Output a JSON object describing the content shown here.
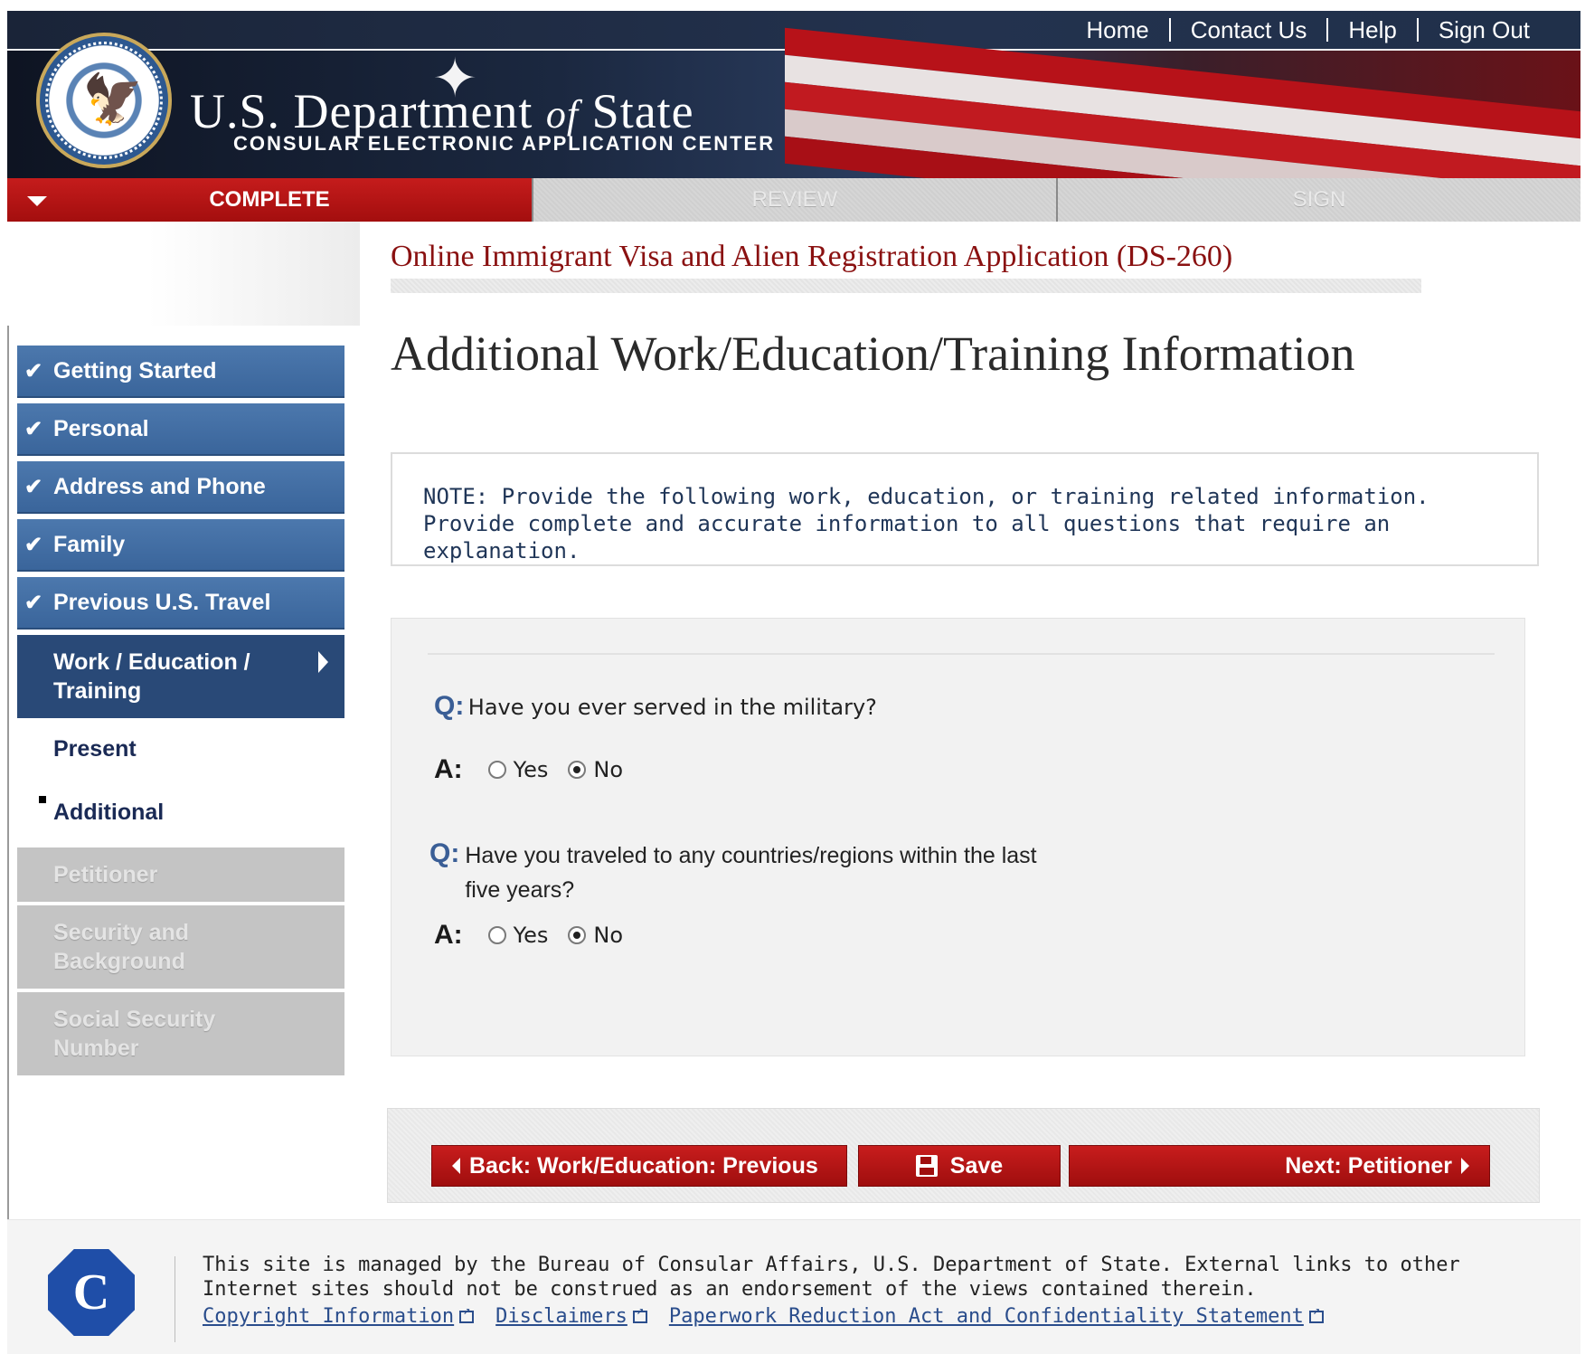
{
  "header": {
    "links": [
      "Home",
      "Contact Us",
      "Help",
      "Sign Out"
    ],
    "seal_icon": "department-of-state-seal",
    "title_part1": "U.S. Department ",
    "title_of": "of",
    "title_part2": " State",
    "subtitle": "CONSULAR ELECTRONIC APPLICATION CENTER"
  },
  "tabs": {
    "complete": "COMPLETE",
    "review": "REVIEW",
    "sign": "SIGN"
  },
  "sidebar": {
    "done": [
      "Getting Started",
      "Personal",
      "Address and Phone",
      "Family",
      "Previous U.S. Travel"
    ],
    "current": "Work / Education / Training",
    "subitems": [
      "Present",
      "Additional"
    ],
    "disabled": [
      "Petitioner",
      "Security and Background",
      "Social Security Number"
    ]
  },
  "main": {
    "app_title": "Online Immigrant Visa and Alien Registration Application (DS-260)",
    "page_title": "Additional Work/Education/Training Information",
    "note": "NOTE: Provide the following work, education, or training related information. Provide complete and accurate information to all questions that require an explanation."
  },
  "questions": [
    {
      "q_label": "Q:",
      "a_label": "A:",
      "question": "Have you ever served in the military?",
      "options": [
        "Yes",
        "No"
      ],
      "selected": "No"
    },
    {
      "q_label": "Q:",
      "a_label": "A:",
      "question_line1": "Have you traveled to any countries/regions within the last",
      "question_line2": "five years?",
      "options": [
        "Yes",
        "No"
      ],
      "selected": "No"
    }
  ],
  "buttons": {
    "back": "Back: Work/Education: Previous",
    "save": "Save",
    "next": "Next: Petitioner"
  },
  "footer": {
    "logo_letter": "C",
    "text": "This site is managed by the Bureau of Consular Affairs, U.S. Department of State. External links to other Internet sites should not be construed as an endorsement of the views contained therein.",
    "links": [
      "Copyright Information",
      "Disclaimers",
      "Paperwork Reduction Act and Confidentiality Statement"
    ]
  },
  "colors": {
    "header_dark": "#1b2840",
    "accent_red": "#a30e0e",
    "nav_blue": "#3a659b",
    "nav_current": "#294977",
    "title_red": "#8a1111"
  }
}
